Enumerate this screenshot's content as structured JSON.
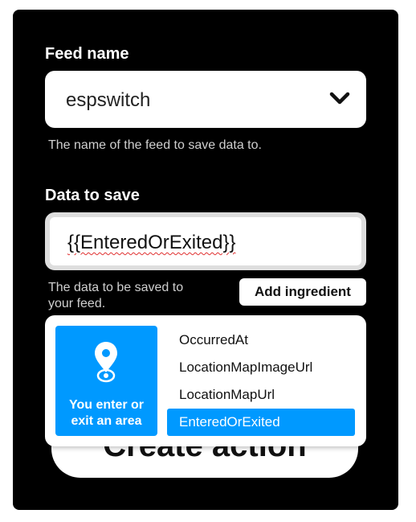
{
  "feed_name": {
    "label": "Feed name",
    "value": "espswitch",
    "helper": "The name of the feed to save data to."
  },
  "data_to_save": {
    "label": "Data to save",
    "value": "{{EnteredOrExited}}",
    "helper_line1": "The data to be saved to",
    "helper_line2": "your feed."
  },
  "add_ingredient_label": "Add ingredient",
  "create_action_label": "Create action",
  "ingredients_dropdown": {
    "trigger_name_line1": "You enter or",
    "trigger_name_line2": "exit an area",
    "trigger_icon": "location-pin-icon",
    "items": [
      "OccurredAt",
      "LocationMapImageUrl",
      "LocationMapUrl",
      "EnteredOrExited"
    ],
    "selected": "EnteredOrExited"
  },
  "colors": {
    "panel_bg": "#000000",
    "accent": "#0099ff"
  }
}
